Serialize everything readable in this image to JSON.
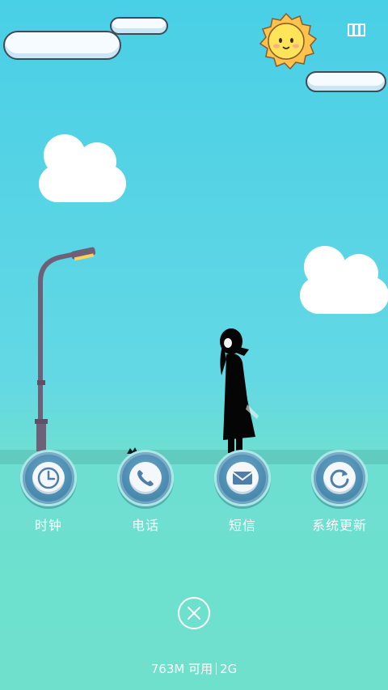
{
  "colors": {
    "sky_top": "#49cfe6",
    "ground": "#6fe0cc",
    "dock_button": "#4a8bb0",
    "text": "#ffffff"
  },
  "top_bar": {
    "menu_icon": "overflow-menu-icon"
  },
  "dock": [
    {
      "label": "时钟",
      "icon": "clock-icon"
    },
    {
      "label": "电话",
      "icon": "phone-icon"
    },
    {
      "label": "短信",
      "icon": "envelope-icon"
    },
    {
      "label": "系统更新",
      "icon": "refresh-icon"
    }
  ],
  "close_button": {
    "icon": "close-icon"
  },
  "memory": {
    "available": "763M 可用",
    "total": "2G"
  }
}
